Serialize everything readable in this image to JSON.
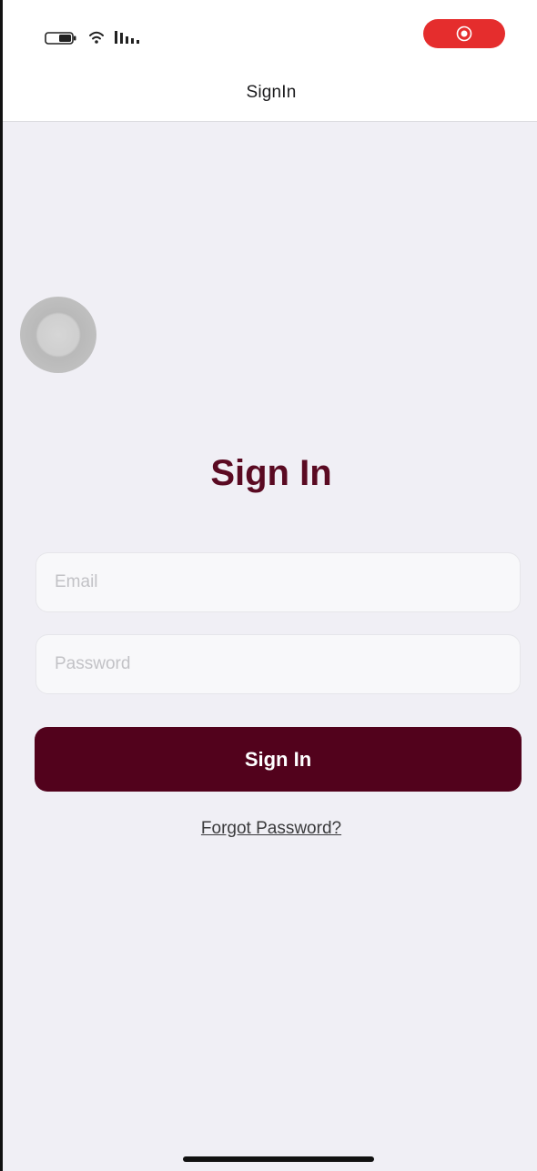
{
  "nav": {
    "title": "SignIn"
  },
  "status_bar": {
    "icons": [
      "battery-icon",
      "wifi-icon",
      "signal-icon"
    ],
    "record_indicator": "screen-record-icon",
    "record_color": "#e52d2d"
  },
  "assistive_touch": {
    "icon": "assistive-touch-icon"
  },
  "form": {
    "heading": "Sign In",
    "email_placeholder": "Email",
    "password_placeholder": "Password",
    "submit_label": "Sign In",
    "forgot_label": "Forgot Password?"
  },
  "colors": {
    "accent": "#52021c",
    "heading": "#5a0a22",
    "background": "#f0eff5"
  }
}
